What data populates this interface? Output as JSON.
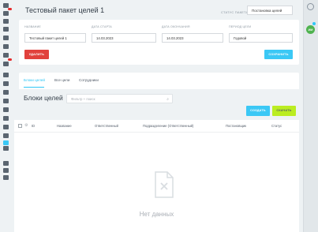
{
  "header": {
    "title": "Тестовый пакет целей 1",
    "status_label": "СТАТУС ПАКЕТА",
    "status_value": "Постановка целей"
  },
  "form": {
    "name_label": "НАЗВАНИЕ",
    "name_value": "Тестовый пакет целей 1",
    "start_label": "ДАТА СТАРТА",
    "start_value": "14.03.2023",
    "end_label": "ДАТА ОКОНЧАНИЯ",
    "end_value": "14.03.2023",
    "period_label": "ПЕРИОД ЦЕЛИ",
    "period_value": "Годовой",
    "delete_label": "УДАЛИТЬ",
    "save_label": "СОХРАНИТЬ"
  },
  "tabs": [
    "Блоки целей",
    "Все цели",
    "Сотрудники"
  ],
  "section": {
    "title": "Блоки целей",
    "filter_placeholder": "Фильтр + поиск",
    "create_label": "СОЗДАТЬ",
    "download_label": "СКАЧАТЬ"
  },
  "table": {
    "columns": [
      "ID",
      "Название",
      "Ответственный",
      "Подразделение (Ответственный)",
      "Постановщик",
      "Статус"
    ],
    "empty_text": "Нет данных"
  },
  "right_rail": {
    "avatar_initials": "ИИ"
  },
  "colors": {
    "accent": "#2fc6f6",
    "danger": "#e1413c",
    "success": "#bbed21"
  }
}
